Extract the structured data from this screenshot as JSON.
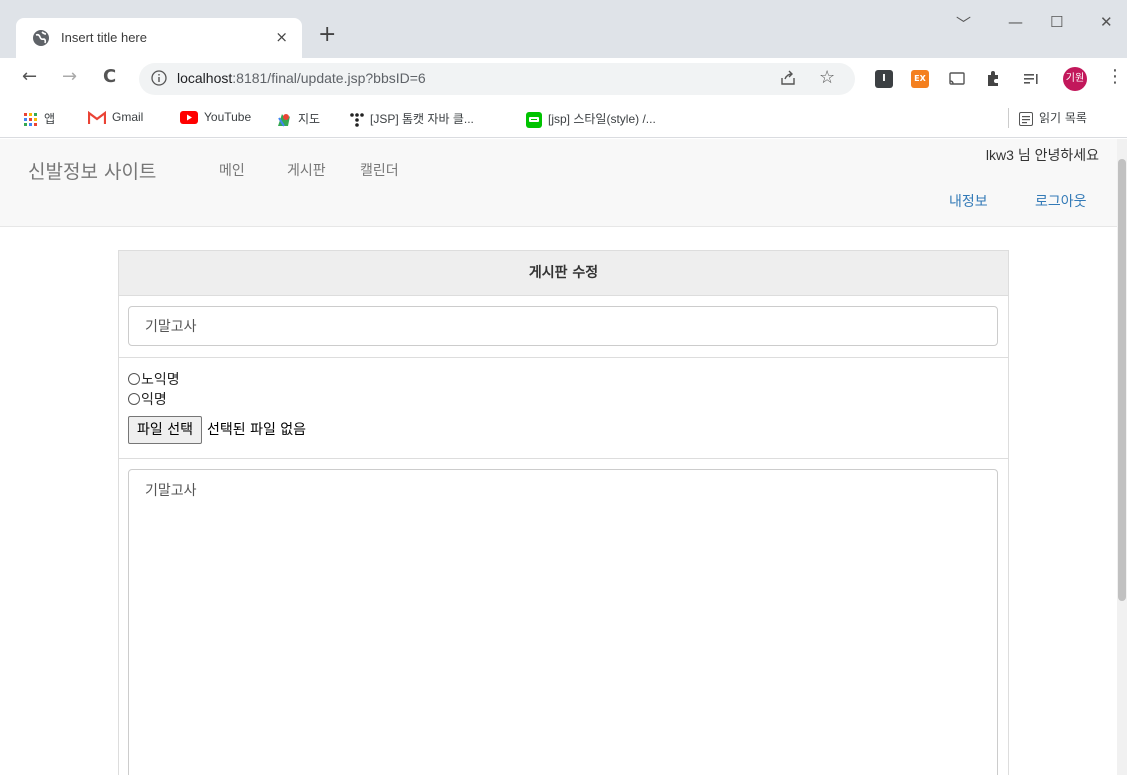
{
  "browser": {
    "tab": {
      "title": "Insert title here",
      "close_glyph": "×"
    },
    "new_tab_glyph": "+",
    "window_controls": {
      "dropdown": "﹀",
      "minimize": "—",
      "maximize": "☐",
      "close": "✕"
    },
    "nav": {
      "back": "←",
      "forward": "→",
      "reload": "C"
    },
    "address": {
      "host": "localhost",
      "path": ":8181/final/update.jsp?bbsID=6"
    },
    "star_glyph": "☆",
    "extensions": [
      {
        "name": "extension-1-icon",
        "color": "#3c4043",
        "label": "I"
      },
      {
        "name": "extension-ex-icon",
        "color": "#f4801f",
        "label": "EX"
      }
    ],
    "profile_label": "기원",
    "menu_glyph": "⋮",
    "bookmarks": [
      {
        "label": "앱",
        "icon": "apps-grid-icon"
      },
      {
        "label": "Gmail",
        "icon": "gmail-icon"
      },
      {
        "label": "YouTube",
        "icon": "youtube-icon"
      },
      {
        "label": "지도",
        "icon": "maps-icon"
      },
      {
        "label": "[JSP] 톰캣 자바 클...",
        "icon": "tistory-icon"
      },
      {
        "label": "[jsp] 스타일(style) /...",
        "icon": "line-chat-icon"
      }
    ],
    "reading_list": "읽기 목록"
  },
  "site": {
    "brand": "신발정보 사이트",
    "nav": [
      "메인",
      "게시판",
      "캘린더"
    ],
    "greeting": "lkw3 님 안녕하세요",
    "user_links": [
      "내정보",
      "로그아웃"
    ]
  },
  "form": {
    "heading": "게시판 수정",
    "title_value": "기말고사",
    "radios": [
      "노익명",
      "익명"
    ],
    "file_button": "파일 선택",
    "file_status": "선택된 파일 없음",
    "content_value": "기말고사"
  },
  "colors": {
    "link": "#337ab7",
    "profile": "#c2185b",
    "panel_header": "#eeeeee"
  }
}
